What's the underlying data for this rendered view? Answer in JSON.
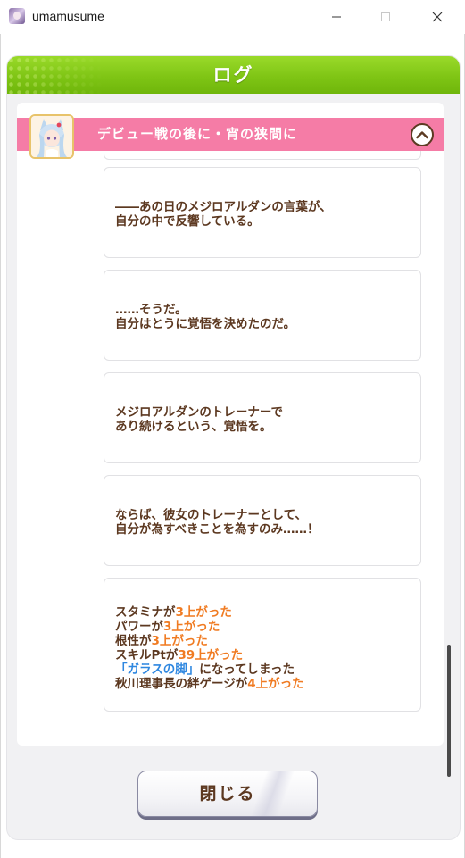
{
  "window": {
    "title": "umamusume",
    "app_icon": "umamusume-app-icon",
    "controls": {
      "minimize_icon": "minimize-icon",
      "maximize_icon": "maximize-icon",
      "close_icon": "close-icon"
    }
  },
  "header": {
    "title": "ログ",
    "color": "#7fc515"
  },
  "chapter": {
    "title": "デビュー戦の後に・宵の狭間に",
    "bar_color": "#f57ca6",
    "collapse_icon": "chevron-up-icon",
    "avatar": "character-portrait"
  },
  "entries": [
    {
      "lines": [
        "――あの日のメジロアルダンの言葉が、",
        "自分の中で反響している。"
      ]
    },
    {
      "lines": [
        "……そうだ。",
        "自分はとうに覚悟を決めたのだ。"
      ]
    },
    {
      "lines": [
        "メジロアルダンのトレーナーで",
        "あり続けるという、覚悟を。"
      ]
    },
    {
      "lines": [
        "ならば、彼女のトレーナーとして、",
        "自分が為すべきことを為すのみ……！"
      ]
    }
  ],
  "results": [
    {
      "pre": "スタミナが",
      "value": "3上がった",
      "post": ""
    },
    {
      "pre": "パワーが",
      "value": "3上がった",
      "post": ""
    },
    {
      "pre": "根性が",
      "value": "3上がった",
      "post": ""
    },
    {
      "pre": "スキルPtが",
      "value": "39上がった",
      "post": ""
    },
    {
      "pre": "",
      "value": "",
      "post": "になってしまった",
      "skill": "「ガラスの脚」"
    },
    {
      "pre": "秋川理事長の絆ゲージが",
      "value": "4上がった",
      "post": ""
    }
  ],
  "colors": {
    "text": "#5c3820",
    "highlight": "#f07b22",
    "skill": "#2e87e0"
  },
  "footer": {
    "close_label": "閉じる"
  }
}
